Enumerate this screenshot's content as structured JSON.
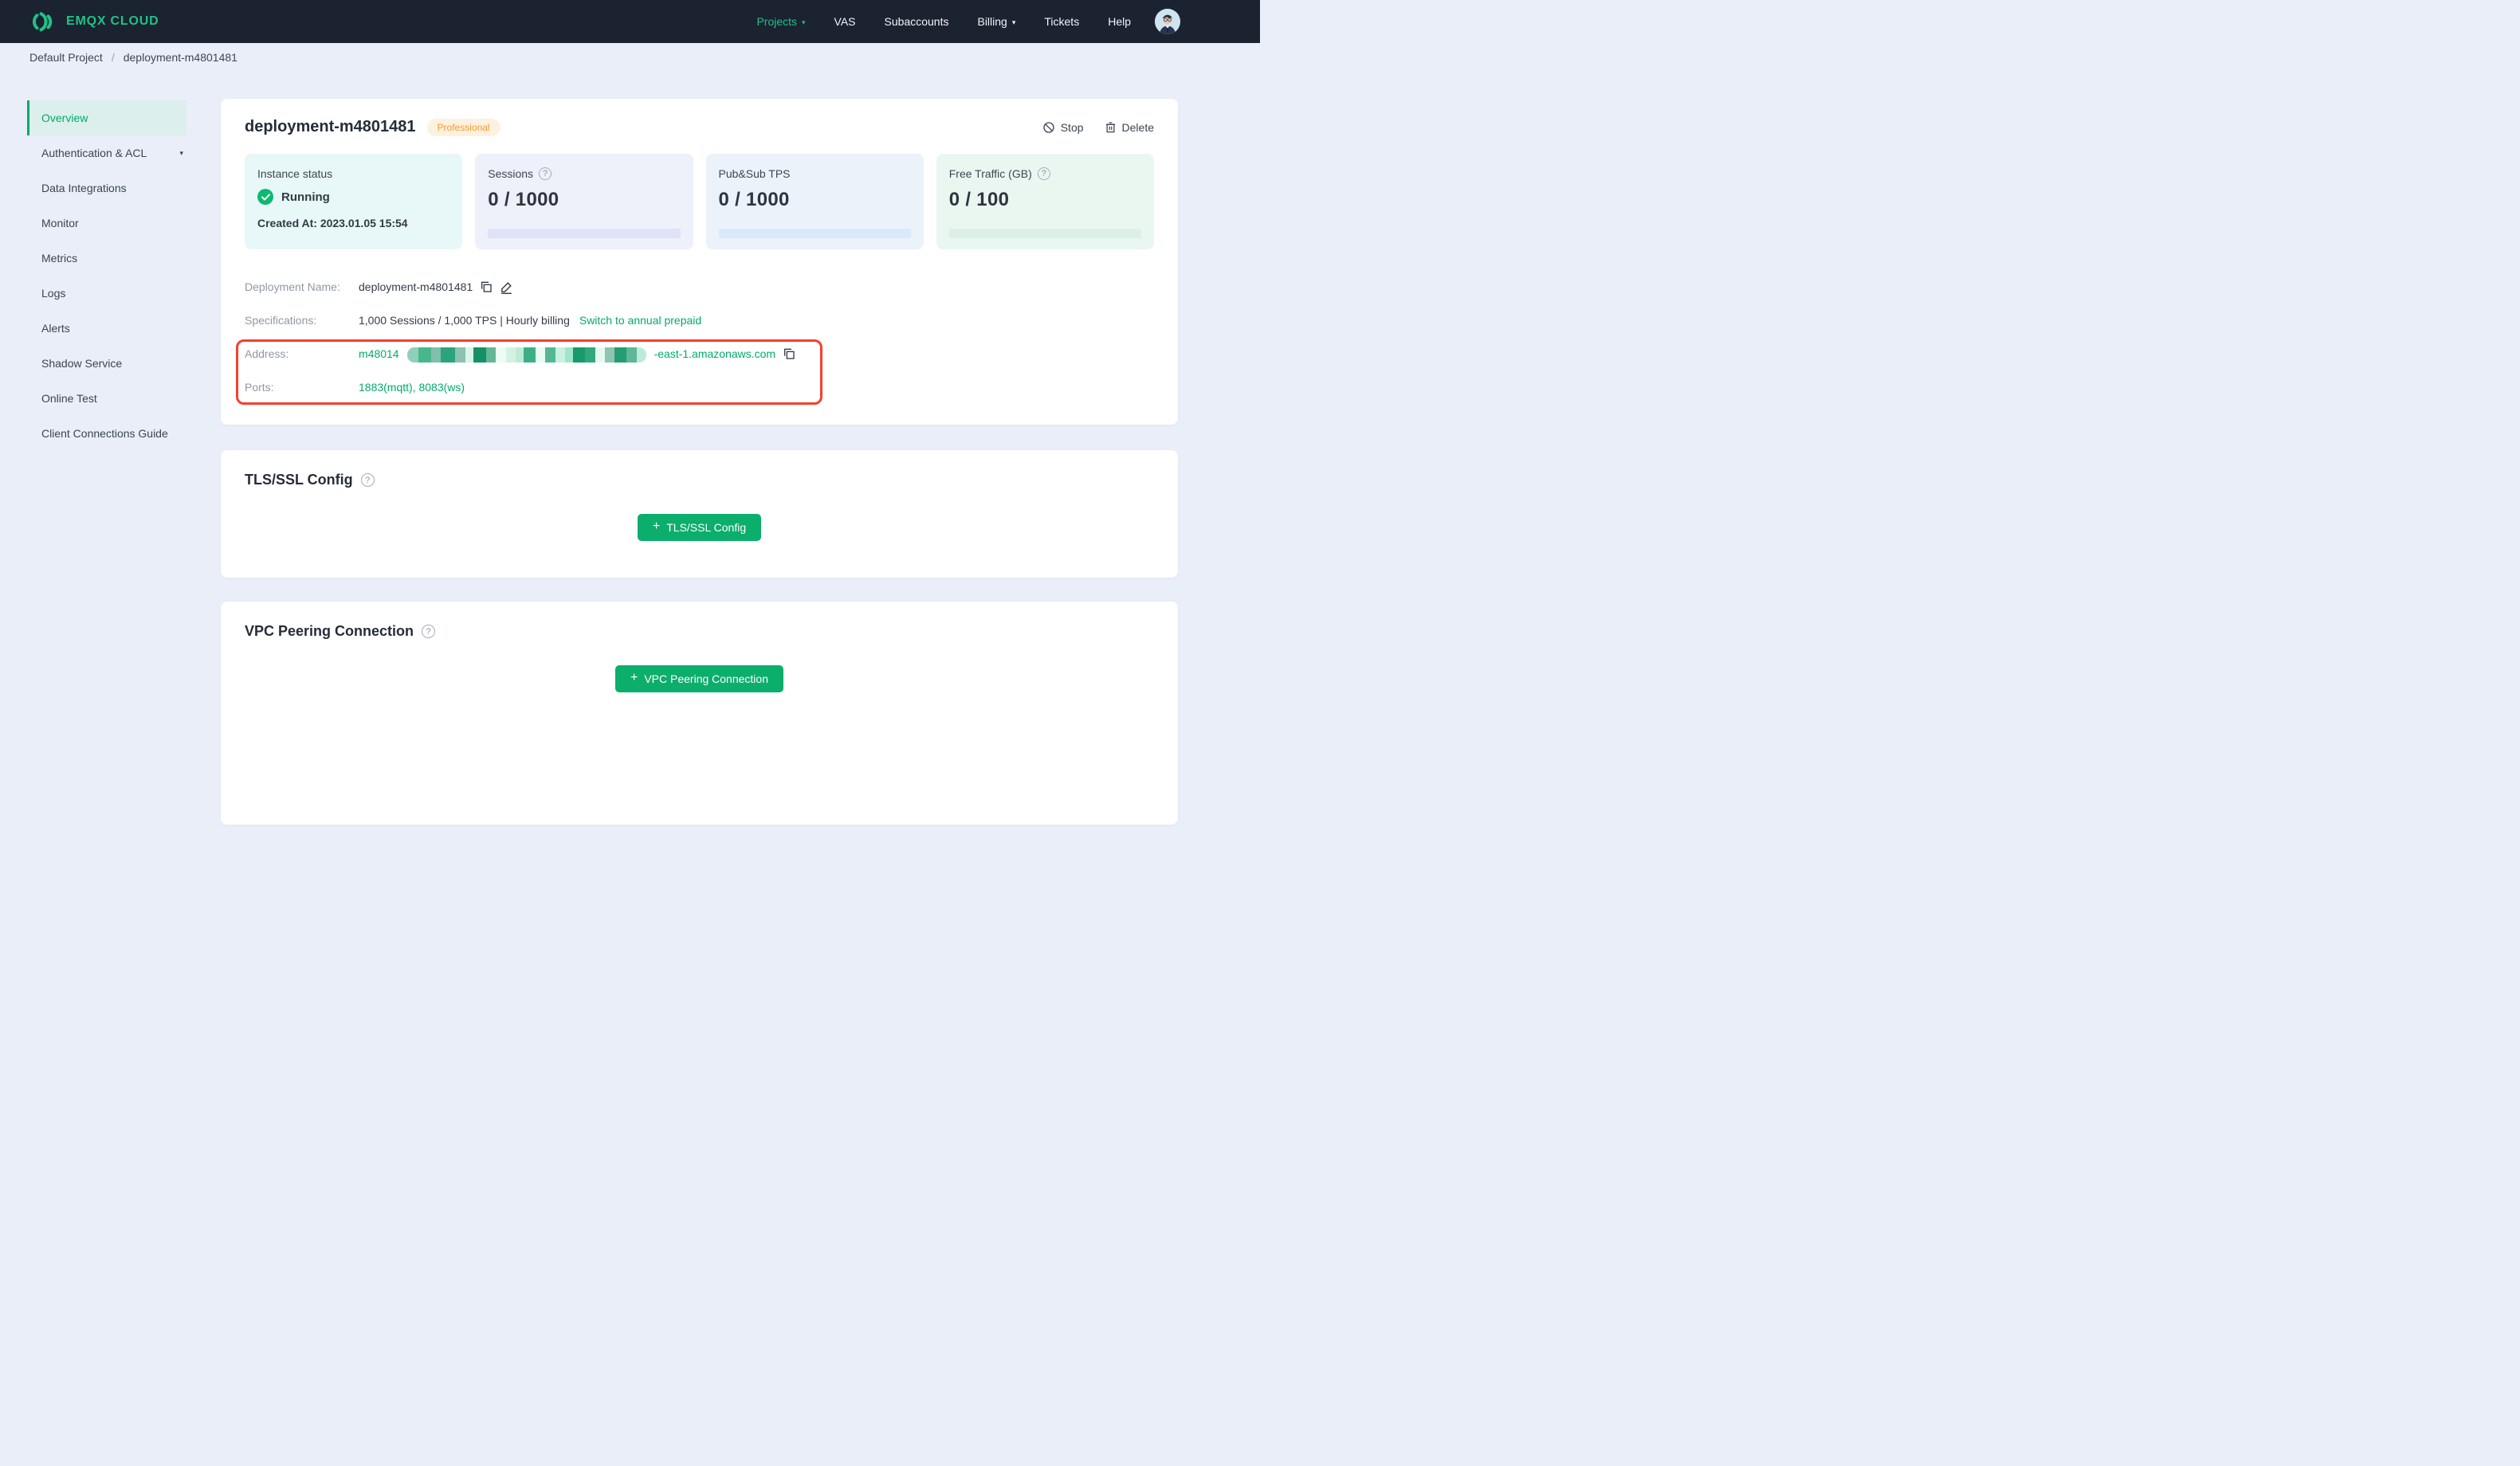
{
  "theme": {
    "nav_bg": "#1b2230",
    "page_bg": "#e9eef8",
    "brand_green": "#1fc287",
    "accent_green": "#00ab6b",
    "button_green": "#0cae6c",
    "check_green": "#0db873",
    "active_bg": "#dcefec",
    "badge_bg": "#fdf1e0",
    "badge_text": "#f99c27",
    "annotation_red": "#f5402d",
    "stat1_bg": "#e8f7f7",
    "stat2_bg": "#eef0fa",
    "stat3_bg": "#ecf2fa",
    "stat4_bg": "#eaf7f1",
    "bar2": "#dfe3f8",
    "bar3": "#d8eafa",
    "bar4": "#ddf0e8"
  },
  "icons": {
    "help": "?",
    "caret": "▾",
    "plus": "+"
  },
  "nav": {
    "brand": "EMQX CLOUD",
    "items": [
      {
        "label": "Projects"
      },
      {
        "label": "VAS"
      },
      {
        "label": "Subaccounts"
      },
      {
        "label": "Billing"
      },
      {
        "label": "Tickets"
      },
      {
        "label": "Help"
      }
    ]
  },
  "breadcrumb": {
    "project": "Default Project",
    "separator": "/",
    "current": "deployment-m4801481"
  },
  "sidebar": {
    "items": [
      {
        "label": "Overview"
      },
      {
        "label": "Authentication & ACL"
      },
      {
        "label": "Data Integrations"
      },
      {
        "label": "Monitor"
      },
      {
        "label": "Metrics"
      },
      {
        "label": "Logs"
      },
      {
        "label": "Alerts"
      },
      {
        "label": "Shadow Service"
      },
      {
        "label": "Online Test"
      },
      {
        "label": "Client Connections Guide"
      }
    ]
  },
  "deployment": {
    "title": "deployment-m4801481",
    "badge": "Professional",
    "actions": {
      "stop": "Stop",
      "delete": "Delete"
    },
    "stats": {
      "instance": {
        "label": "Instance status",
        "status": "Running",
        "created": "Created At: 2023.01.05 15:54"
      },
      "sessions": {
        "label": "Sessions",
        "value": "0 / 1000"
      },
      "tps": {
        "label": "Pub&Sub TPS",
        "value": "0 / 1000"
      },
      "traffic": {
        "label": "Free Traffic (GB)",
        "value": "0 / 100"
      }
    },
    "details": {
      "name": {
        "label": "Deployment Name:",
        "value": "deployment-m4801481"
      },
      "specs": {
        "label": "Specifications:",
        "value": "1,000 Sessions / 1,000 TPS | Hourly billing",
        "link": "Switch to annual prepaid"
      },
      "address": {
        "label": "Address:",
        "prefix": "m48014",
        "suffix": "-east-1.amazonaws.com",
        "redaction": [
          {
            "c": "#8fd0bc",
            "w": 14
          },
          {
            "c": "#47b88d",
            "w": 16
          },
          {
            "c": "#7fbfae",
            "w": 12
          },
          {
            "c": "#2ba47c",
            "w": 18
          },
          {
            "c": "#8cc2b1",
            "w": 13
          },
          {
            "c": "#d9f4e8",
            "w": 10
          },
          {
            "c": "#15916a",
            "w": 16
          },
          {
            "c": "#63b797",
            "w": 12
          },
          {
            "c": "#eefcf6",
            "w": 13
          },
          {
            "c": "#d4f2e4",
            "w": 12
          },
          {
            "c": "#bfead9",
            "w": 10
          },
          {
            "c": "#3daf87",
            "w": 15
          },
          {
            "c": "#e9fbf3",
            "w": 12
          },
          {
            "c": "#56b795",
            "w": 13
          },
          {
            "c": "#c9f0e0",
            "w": 12
          },
          {
            "c": "#9fe6ca",
            "w": 10
          },
          {
            "c": "#18996e",
            "w": 15
          },
          {
            "c": "#33a87d",
            "w": 13
          },
          {
            "c": "#e6f9f1",
            "w": 12
          },
          {
            "c": "#8fc4b2",
            "w": 12
          },
          {
            "c": "#259c72",
            "w": 15
          },
          {
            "c": "#5cb898",
            "w": 13
          },
          {
            "c": "#bdebd9",
            "w": 12
          }
        ]
      },
      "ports": {
        "label": "Ports:",
        "value": "1883(mqtt), 8083(ws)"
      }
    }
  },
  "sections": {
    "tls": {
      "title": "TLS/SSL Config",
      "button": "TLS/SSL Config"
    },
    "vpc": {
      "title": "VPC Peering Connection",
      "button": "VPC Peering Connection"
    }
  }
}
